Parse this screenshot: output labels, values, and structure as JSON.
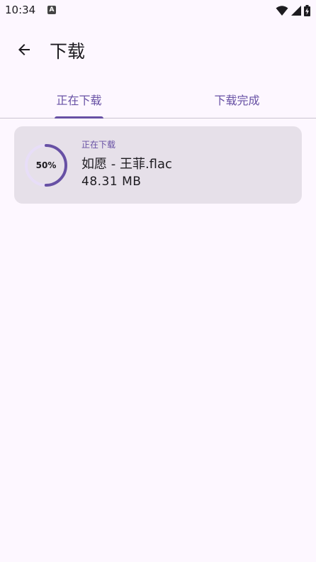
{
  "status_bar": {
    "time": "10:34",
    "notification_icon": "A",
    "icons": [
      "wifi-icon",
      "signal-icon",
      "battery-charging-icon"
    ]
  },
  "app_bar": {
    "back_icon": "arrow-back-icon",
    "title": "下载"
  },
  "tabs": [
    {
      "label": "正在下载",
      "selected": true
    },
    {
      "label": "下载完成",
      "selected": false
    }
  ],
  "downloads": [
    {
      "status": "正在下载",
      "file_name": "如愿 - 王菲.flac",
      "size": "48.31 MB",
      "progress_label": "50%",
      "progress": 0.5
    }
  ],
  "colors": {
    "accent": "#6750a4",
    "background": "#fdf7ff",
    "card": "#e6e0e9",
    "track": "#e8def8"
  }
}
